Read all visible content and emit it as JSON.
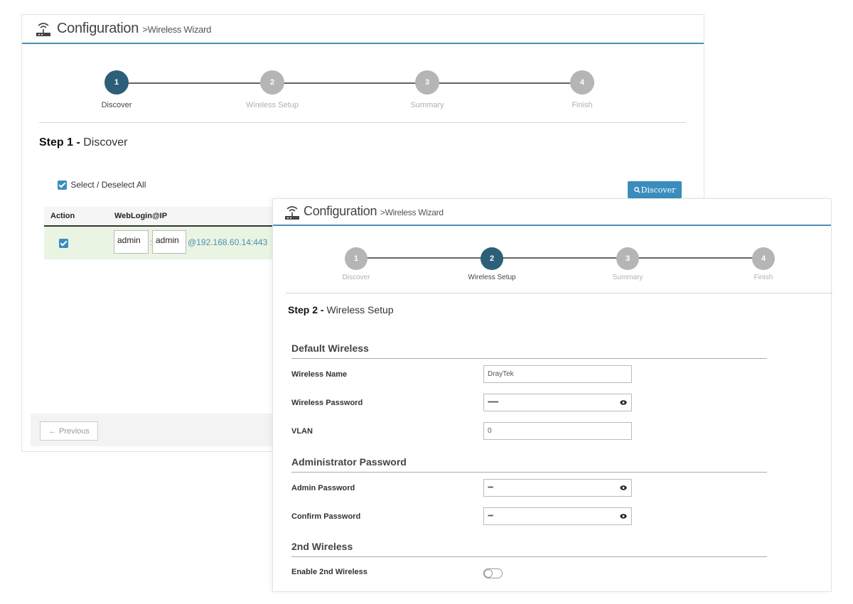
{
  "panel1": {
    "title": "Configuration",
    "subtitle": ">Wireless Wizard",
    "steps": [
      {
        "num": "1",
        "label": "Discover"
      },
      {
        "num": "2",
        "label": "Wireless Setup"
      },
      {
        "num": "3",
        "label": "Summary"
      },
      {
        "num": "4",
        "label": "Finish"
      }
    ],
    "active_step": 1,
    "step_prefix": "Step 1 -",
    "step_name": "Discover",
    "select_all_label": "Select / Deselect All",
    "discover_button": "Discover",
    "table": {
      "headers": [
        "Action",
        "WebLogin@IP"
      ],
      "rows": [
        {
          "checked": true,
          "username": "admin",
          "password": "admin",
          "ip": "@192.168.60.14:443"
        }
      ]
    },
    "previous_button": "Previous"
  },
  "panel2": {
    "title": "Configuration",
    "subtitle": ">Wireless Wizard",
    "steps": [
      {
        "num": "1",
        "label": "Discover"
      },
      {
        "num": "2",
        "label": "Wireless Setup"
      },
      {
        "num": "3",
        "label": "Summary"
      },
      {
        "num": "4",
        "label": "Finish"
      }
    ],
    "active_step": 2,
    "step_prefix": "Step 2 -",
    "step_name": "Wireless Setup",
    "sections": {
      "default_wireless": {
        "title": "Default Wireless",
        "wireless_name_label": "Wireless Name",
        "wireless_name_value": "DrayTek",
        "wireless_password_label": "Wireless Password",
        "wireless_password_value": "••••••••••",
        "vlan_label": "VLAN",
        "vlan_value": "0"
      },
      "admin_password": {
        "title": "Administrator Password",
        "admin_password_label": "Admin Password",
        "admin_password_value": "•••••",
        "confirm_password_label": "Confirm Password",
        "confirm_password_value": "•••••"
      },
      "second_wireless": {
        "title": "2nd Wireless",
        "enable_label": "Enable 2nd Wireless",
        "enabled": false
      }
    }
  },
  "colors": {
    "accent": "#3a8dbd",
    "active_step": "#2d5f78",
    "inactive_step": "#b5b5b5",
    "header_rule": "#4a90b4",
    "row_highlight": "#eaf4e2"
  }
}
